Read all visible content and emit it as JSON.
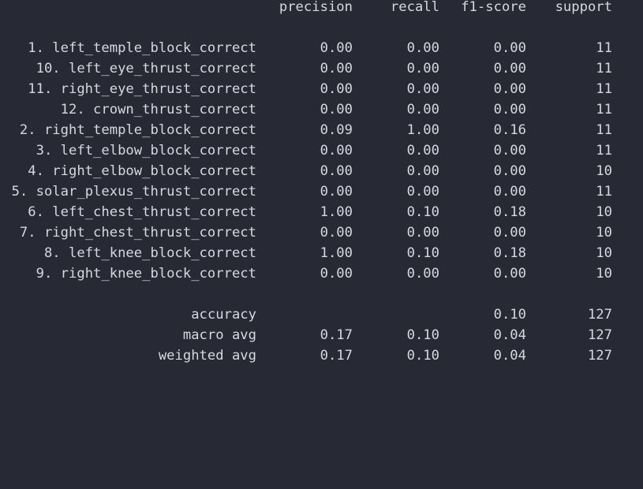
{
  "header": {
    "precision": "precision",
    "recall": "recall",
    "f1_score": "f1-score",
    "support": "support"
  },
  "classes": [
    {
      "label": "1. left_temple_block_correct",
      "precision": "0.00",
      "recall": "0.00",
      "f1_score": "0.00",
      "support": "11"
    },
    {
      "label": "10. left_eye_thrust_correct",
      "precision": "0.00",
      "recall": "0.00",
      "f1_score": "0.00",
      "support": "11"
    },
    {
      "label": "11. right_eye_thrust_correct",
      "precision": "0.00",
      "recall": "0.00",
      "f1_score": "0.00",
      "support": "11"
    },
    {
      "label": "12. crown_thrust_correct",
      "precision": "0.00",
      "recall": "0.00",
      "f1_score": "0.00",
      "support": "11"
    },
    {
      "label": "2. right_temple_block_correct",
      "precision": "0.09",
      "recall": "1.00",
      "f1_score": "0.16",
      "support": "11"
    },
    {
      "label": "3. left_elbow_block_correct",
      "precision": "0.00",
      "recall": "0.00",
      "f1_score": "0.00",
      "support": "11"
    },
    {
      "label": "4. right_elbow_block_correct",
      "precision": "0.00",
      "recall": "0.00",
      "f1_score": "0.00",
      "support": "10"
    },
    {
      "label": "5. solar_plexus_thrust_correct",
      "precision": "0.00",
      "recall": "0.00",
      "f1_score": "0.00",
      "support": "11"
    },
    {
      "label": "6. left_chest_thrust_correct",
      "precision": "1.00",
      "recall": "0.10",
      "f1_score": "0.18",
      "support": "10"
    },
    {
      "label": "7. right_chest_thrust_correct",
      "precision": "0.00",
      "recall": "0.00",
      "f1_score": "0.00",
      "support": "10"
    },
    {
      "label": "8. left_knee_block_correct",
      "precision": "1.00",
      "recall": "0.10",
      "f1_score": "0.18",
      "support": "10"
    },
    {
      "label": "9. right_knee_block_correct",
      "precision": "0.00",
      "recall": "0.00",
      "f1_score": "0.00",
      "support": "10"
    }
  ],
  "summary": [
    {
      "label": "accuracy",
      "precision": "",
      "recall": "",
      "f1_score": "0.10",
      "support": "127"
    },
    {
      "label": "macro avg",
      "precision": "0.17",
      "recall": "0.10",
      "f1_score": "0.04",
      "support": "127"
    },
    {
      "label": "weighted avg",
      "precision": "0.17",
      "recall": "0.10",
      "f1_score": "0.04",
      "support": "127"
    }
  ],
  "colors": {
    "background": "#272a34",
    "text": "#d6d8de"
  }
}
